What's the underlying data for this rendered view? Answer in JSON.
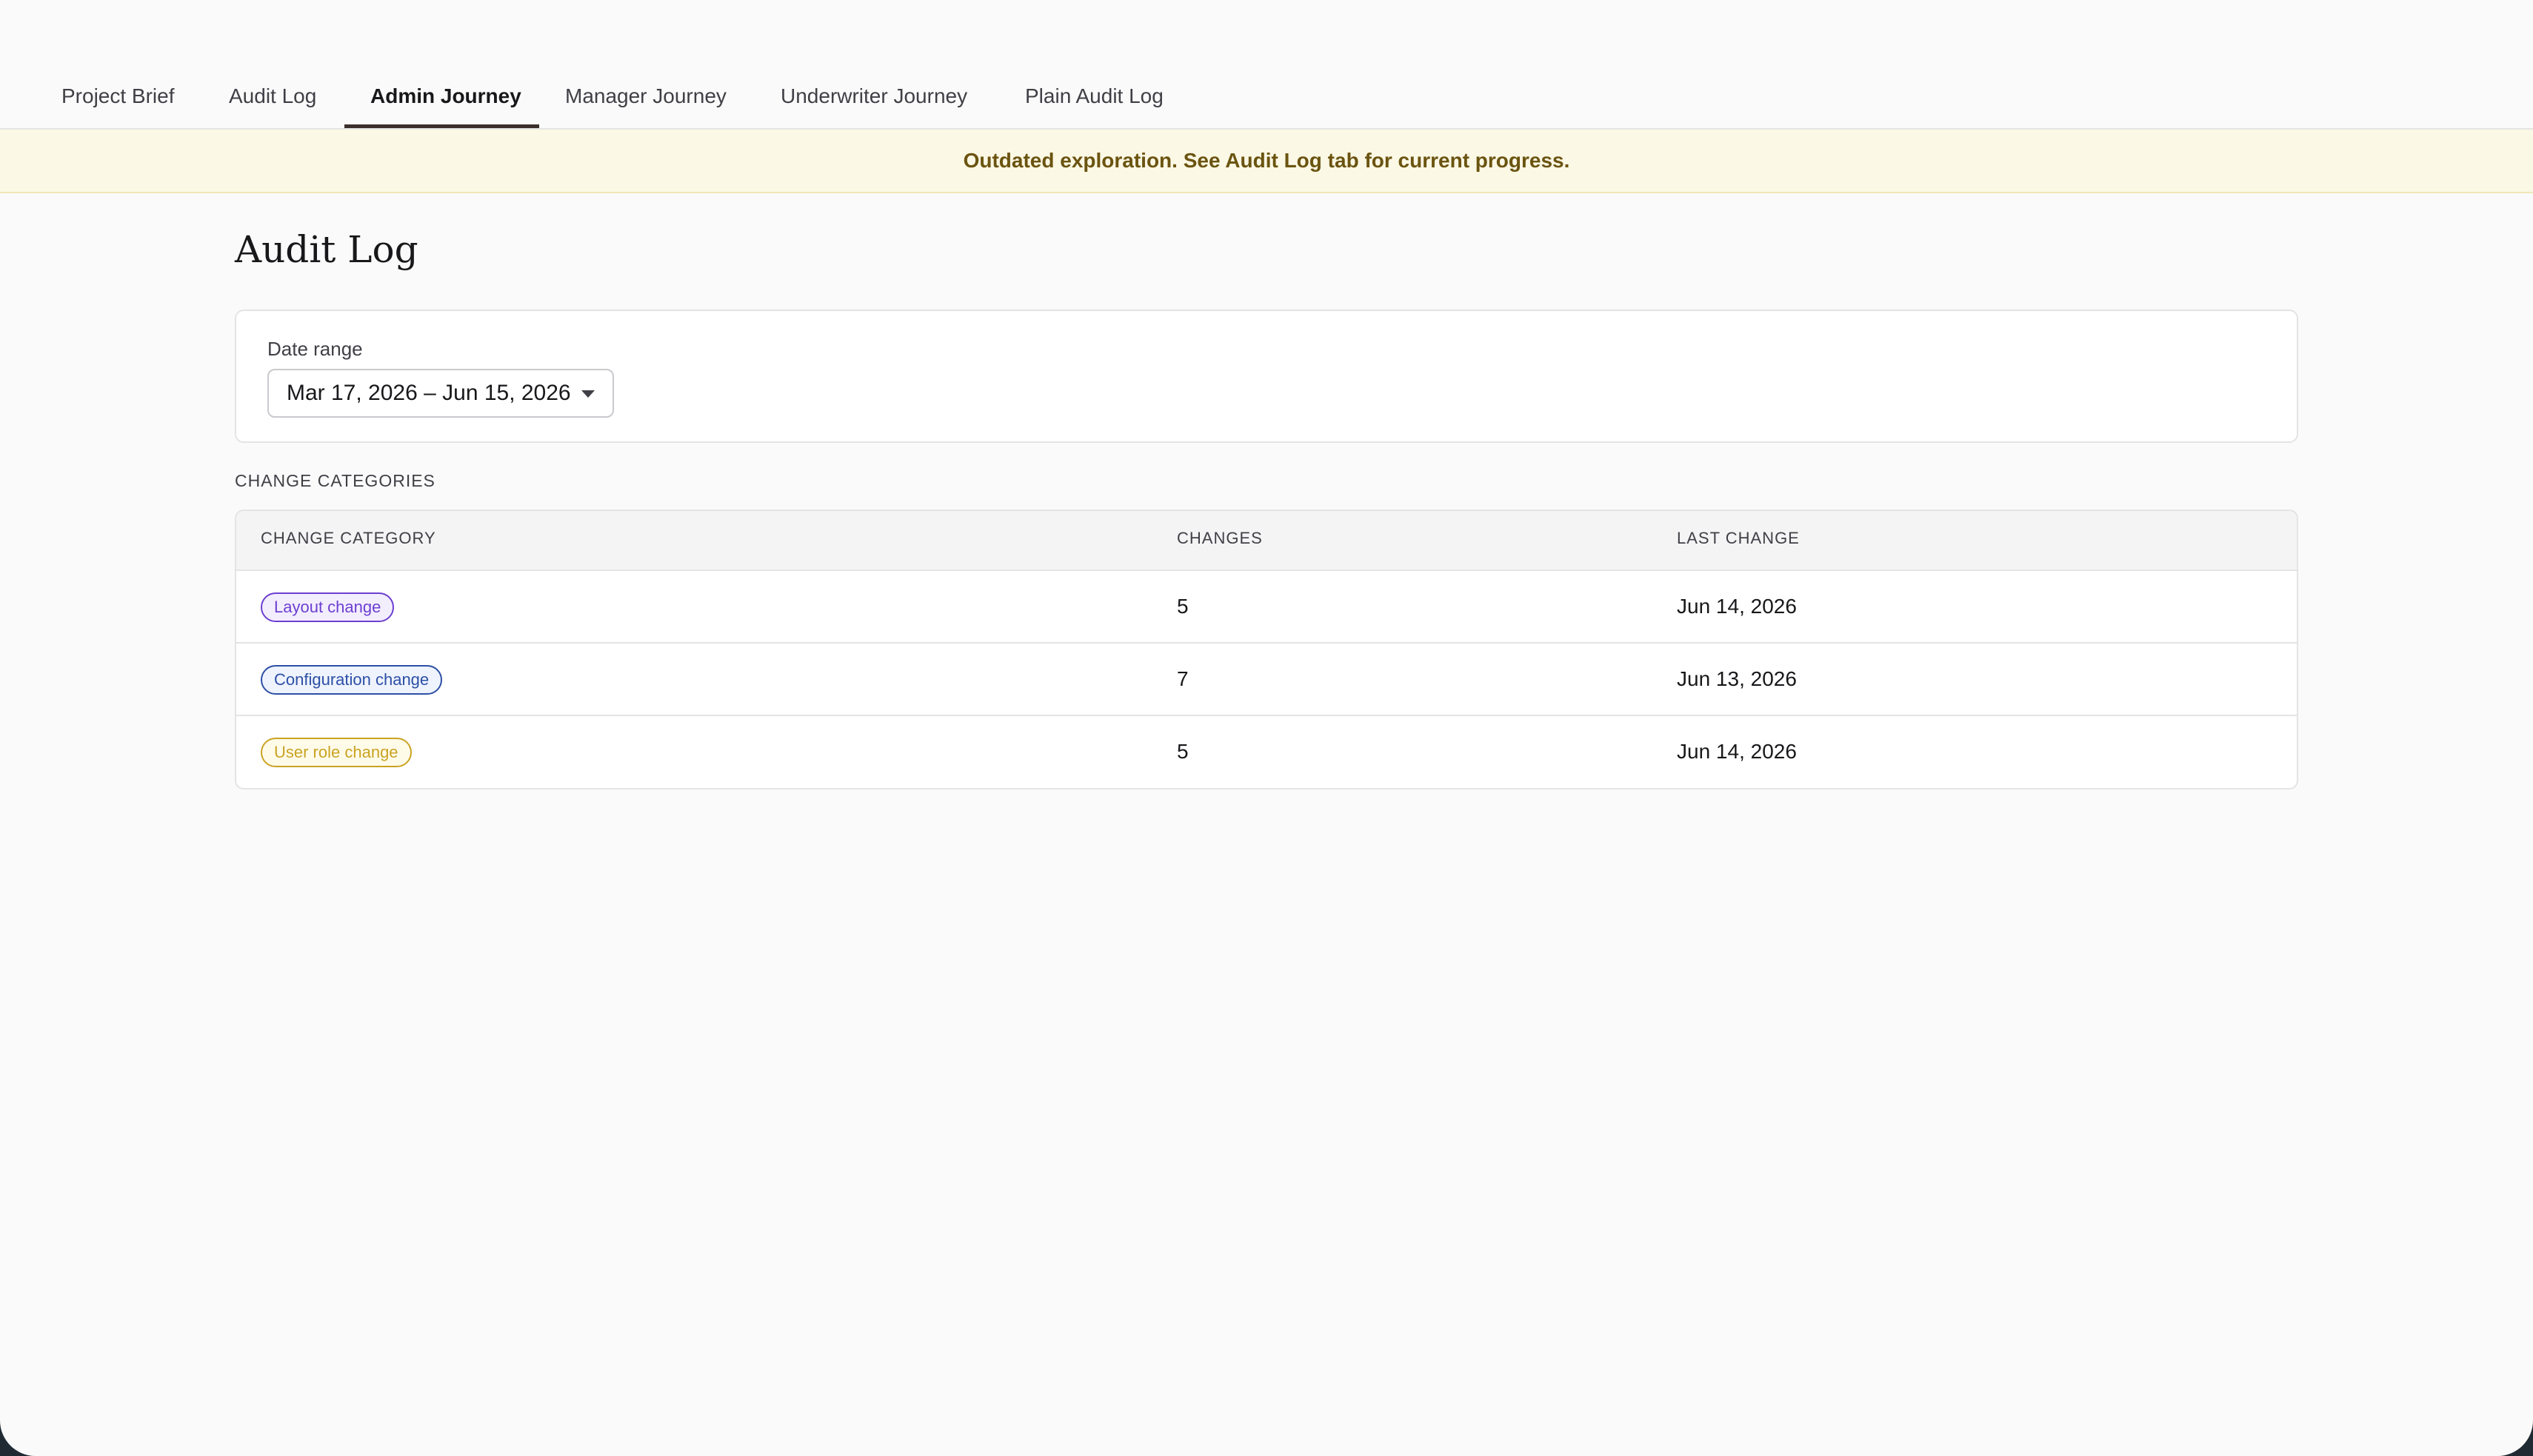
{
  "tabs": [
    {
      "label": "Project Brief",
      "active": false
    },
    {
      "label": "Audit Log",
      "active": false
    },
    {
      "label": "Admin Journey",
      "active": true
    },
    {
      "label": "Manager Journey",
      "active": false
    },
    {
      "label": "Underwriter Journey",
      "active": false
    },
    {
      "label": "Plain Audit Log",
      "active": false
    }
  ],
  "banner": {
    "text": "Outdated exploration. See Audit Log tab for current progress."
  },
  "page": {
    "title": "Audit Log"
  },
  "filter": {
    "label": "Date range",
    "value": "Mar 17, 2026 – Jun 15, 2026"
  },
  "section": {
    "label": "CHANGE CATEGORIES"
  },
  "table": {
    "headers": [
      "CHANGE CATEGORY",
      "CHANGES",
      "LAST CHANGE"
    ],
    "rows": [
      {
        "category": "Layout change",
        "changes": "5",
        "last_change": "Jun 14, 2026",
        "color": "#6d3fd1",
        "bg": "#f3eefe"
      },
      {
        "category": "Configuration change",
        "changes": "7",
        "last_change": "Jun 13, 2026",
        "color": "#2d4fa6",
        "bg": "#eef3fd"
      },
      {
        "category": "User role change",
        "changes": "5",
        "last_change": "Jun 14, 2026",
        "color": "#caa323",
        "bg": "#fffbe9"
      }
    ]
  },
  "colors": {
    "accent_underline": "#3a2f2c",
    "banner_bg": "#fbf8e5",
    "banner_text": "#6b5410"
  }
}
